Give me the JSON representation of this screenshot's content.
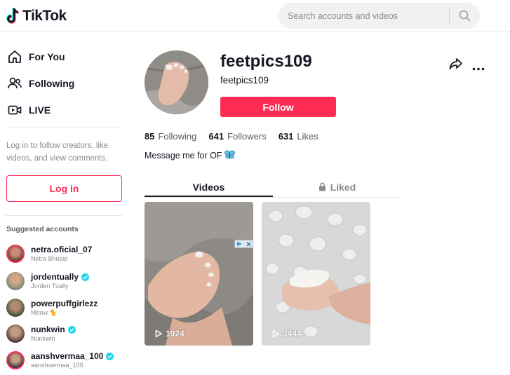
{
  "header": {
    "logo_text": "TikTok",
    "search_placeholder": "Search accounts and videos"
  },
  "sidebar": {
    "nav": [
      {
        "label": "For You",
        "icon": "home-icon"
      },
      {
        "label": "Following",
        "icon": "users-icon"
      },
      {
        "label": "LIVE",
        "icon": "live-video-icon"
      }
    ],
    "login_hint": "Log in to follow creators, like videos, and view comments.",
    "login_label": "Log in",
    "suggested_title": "Suggested accounts",
    "accounts": [
      {
        "handle": "netra.oficial_07",
        "nickname": "Netra Bhusal",
        "verified": false
      },
      {
        "handle": "jordentually",
        "nickname": "Jorden Tually",
        "verified": true
      },
      {
        "handle": "powerpuffgirlezz",
        "nickname": "Meow 🐈",
        "verified": false
      },
      {
        "handle": "nunkwin",
        "nickname": "Nunkwin",
        "verified": true
      },
      {
        "handle": "aanshvermaa_100",
        "nickname": "aanshvermaa_100",
        "verified": true
      }
    ]
  },
  "profile": {
    "title": "feetpics109",
    "subtitle": "feetpics109",
    "follow_label": "Follow",
    "stats": {
      "following_count": "85",
      "following_label": "Following",
      "followers_count": "641",
      "followers_label": "Followers",
      "likes_count": "631",
      "likes_label": "Likes"
    },
    "bio": "Message me for OF"
  },
  "tabs": {
    "videos": "Videos",
    "liked": "Liked"
  },
  "videos": [
    {
      "views": "1924"
    },
    {
      "views": "3444"
    }
  ],
  "colors": {
    "accent": "#fe2c55",
    "verified": "#20d5ec",
    "text": "#161823",
    "muted": "#8a8b91"
  }
}
